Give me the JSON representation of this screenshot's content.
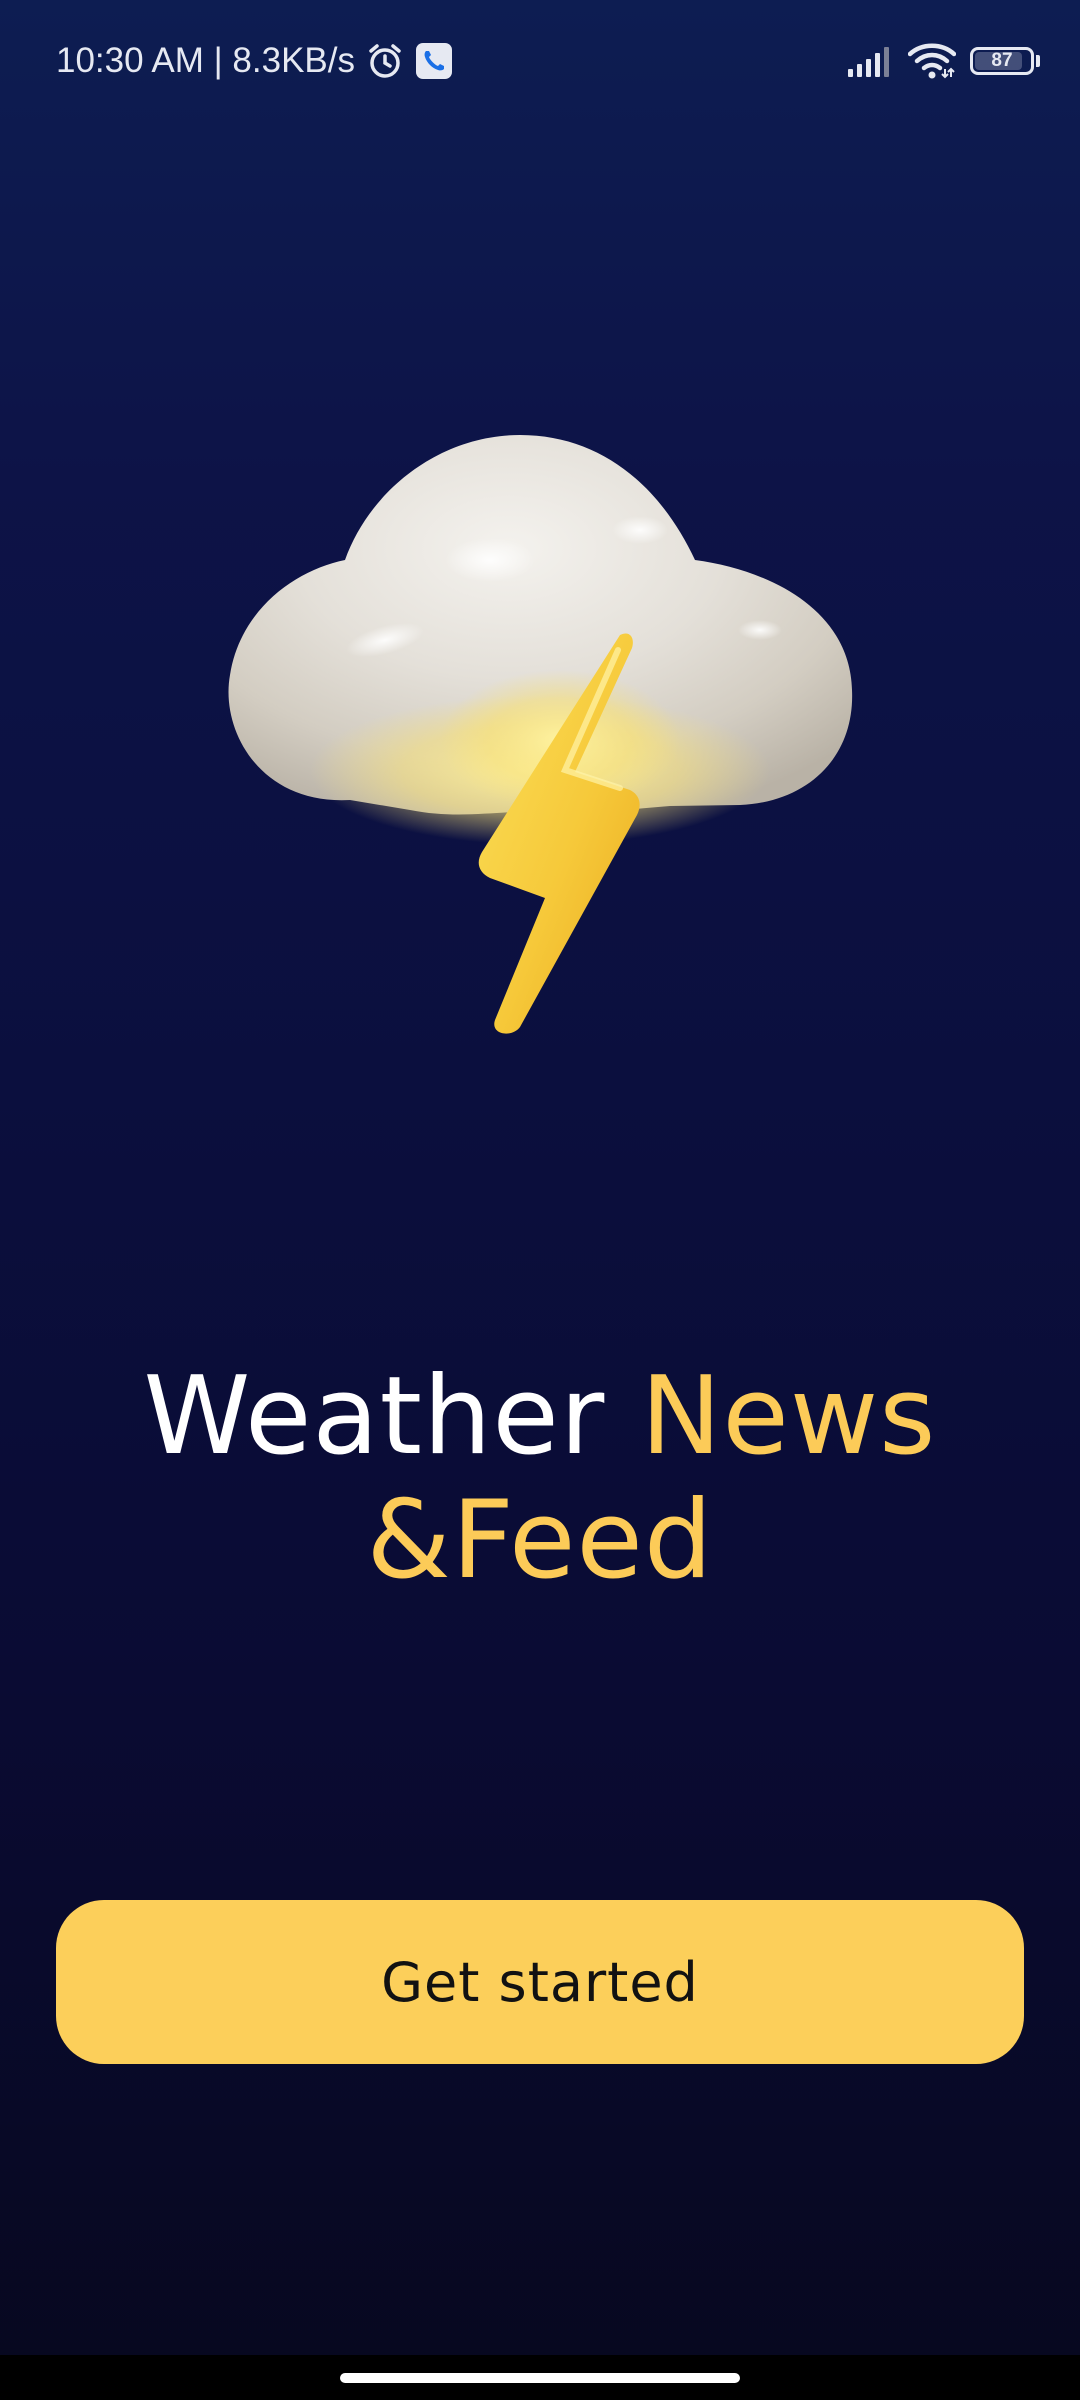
{
  "status_bar": {
    "time_and_speed": "10:30 AM | 8.3KB/s",
    "alarm_icon": "alarm-clock-icon",
    "call_icon": "phone-call-icon",
    "signal_icon": "cellular-signal-icon",
    "wifi_icon": "wifi-icon",
    "battery_level": "87",
    "battery_fraction": 0.87
  },
  "illustration": {
    "icon": "thunderstorm-cloud-icon"
  },
  "headline": {
    "word1": "Weather",
    "word2": "News",
    "line2": "&Feed"
  },
  "cta": {
    "label": "Get started"
  },
  "colors": {
    "background_top": "#0d1d52",
    "background_bottom": "#07081f",
    "accent_yellow": "#fccb58",
    "button_yellow": "#fccf5a",
    "button_text": "#121212"
  }
}
